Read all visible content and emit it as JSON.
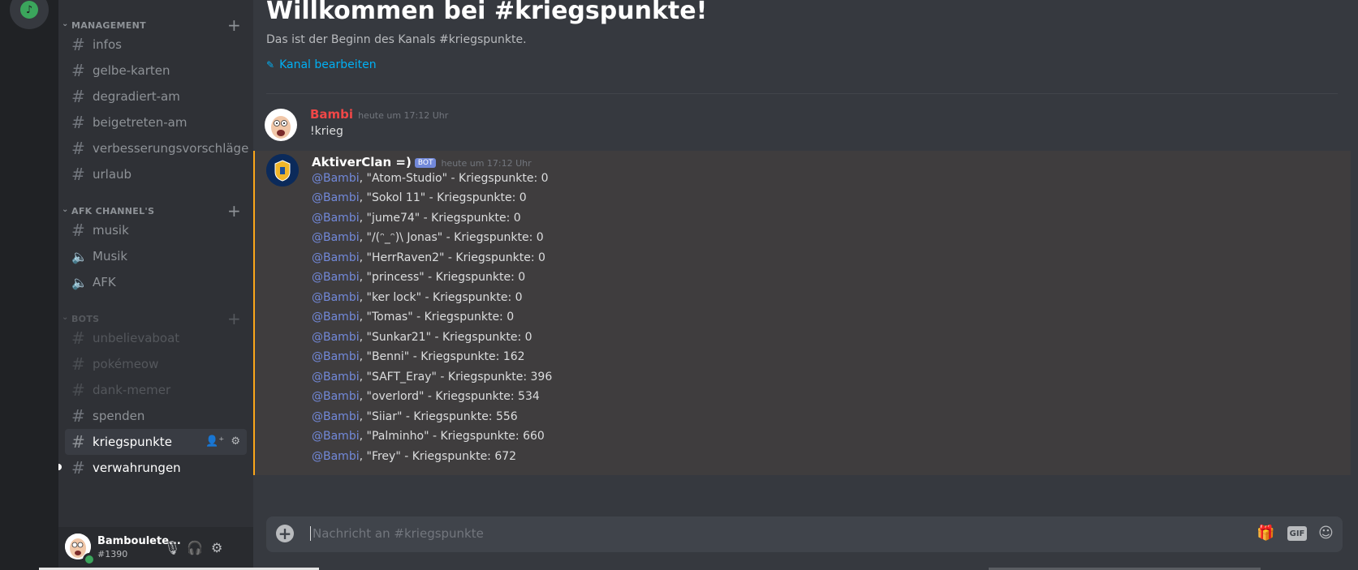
{
  "sidebar": {
    "categories": [
      {
        "label": "MANAGEMENT"
      },
      {
        "label": "AFK CHANNEL'S"
      },
      {
        "label": "BOTS"
      }
    ],
    "channels": [
      {
        "label": "infos",
        "icon": "hash-thread-icon"
      },
      {
        "label": "gelbe-karten",
        "icon": "hash-icon"
      },
      {
        "label": "degradiert-am",
        "icon": "hash-icon"
      },
      {
        "label": "beigetreten-am",
        "icon": "hash-thread-icon"
      },
      {
        "label": "verbesserungsvorschläge",
        "icon": "hash-thread-icon"
      },
      {
        "label": "urlaub",
        "icon": "hash-thread-icon"
      },
      {
        "label": "musik",
        "icon": "hash-icon"
      },
      {
        "label": "Musik",
        "icon": "speaker-icon"
      },
      {
        "label": "AFK",
        "icon": "speaker-icon"
      },
      {
        "label": "unbelievaboat",
        "icon": "hash-icon"
      },
      {
        "label": "pokémeow",
        "icon": "hash-icon"
      },
      {
        "label": "dank-memer",
        "icon": "hash-icon"
      },
      {
        "label": "spenden",
        "icon": "hash-icon"
      },
      {
        "label": "kriegspunkte",
        "icon": "hash-icon"
      },
      {
        "label": "verwahrungen",
        "icon": "hash-icon"
      }
    ]
  },
  "user": {
    "name": "Bamboulete...",
    "tag": "#1390"
  },
  "welcome": {
    "title": "Willkommen bei #kriegspunkte!",
    "subtitle": "Das ist der Beginn des Kanals #kriegspunkte.",
    "edit_label": "Kanal bearbeiten"
  },
  "messages": {
    "first": {
      "author": "Bambi",
      "timestamp": "heute um 17:12 Uhr",
      "text": "!krieg",
      "author_color": "#f04747"
    },
    "bot": {
      "author": "AktiverClan =)",
      "bot_tag": "BOT",
      "timestamp": "heute um 17:12 Uhr",
      "mention": "@Bambi",
      "lines": [
        ", \"Atom-Studio\" - Kriegspunkte: 0",
        ", \"Sokol 11\" - Kriegspunkte: 0",
        ", \"jume74\" - Kriegspunkte: 0",
        ", \"/(ᵔ_ᵔ)\\ Jonas\" - Kriegspunkte: 0",
        ", \"HerrRaven2\" - Kriegspunkte: 0",
        ", \"princess\" - Kriegspunkte: 0",
        ", \"ker lock\" - Kriegspunkte: 0",
        ", \"Tomas\" - Kriegspunkte: 0",
        ", \"Sunkar21\" - Kriegspunkte: 0",
        ", \"Benni\" - Kriegspunkte: 162",
        ", \"SAFT_Eray\" - Kriegspunkte: 396",
        ", \"overlord\" - Kriegspunkte: 534",
        ", \"Siiar\" - Kriegspunkte: 556",
        ", \"Palminho\" - Kriegspunkte: 660",
        ", \"Frey\" - Kriegspunkte: 672"
      ]
    }
  },
  "composer": {
    "placeholder": "Nachricht an #kriegspunkte",
    "gif_label": "GIF"
  }
}
